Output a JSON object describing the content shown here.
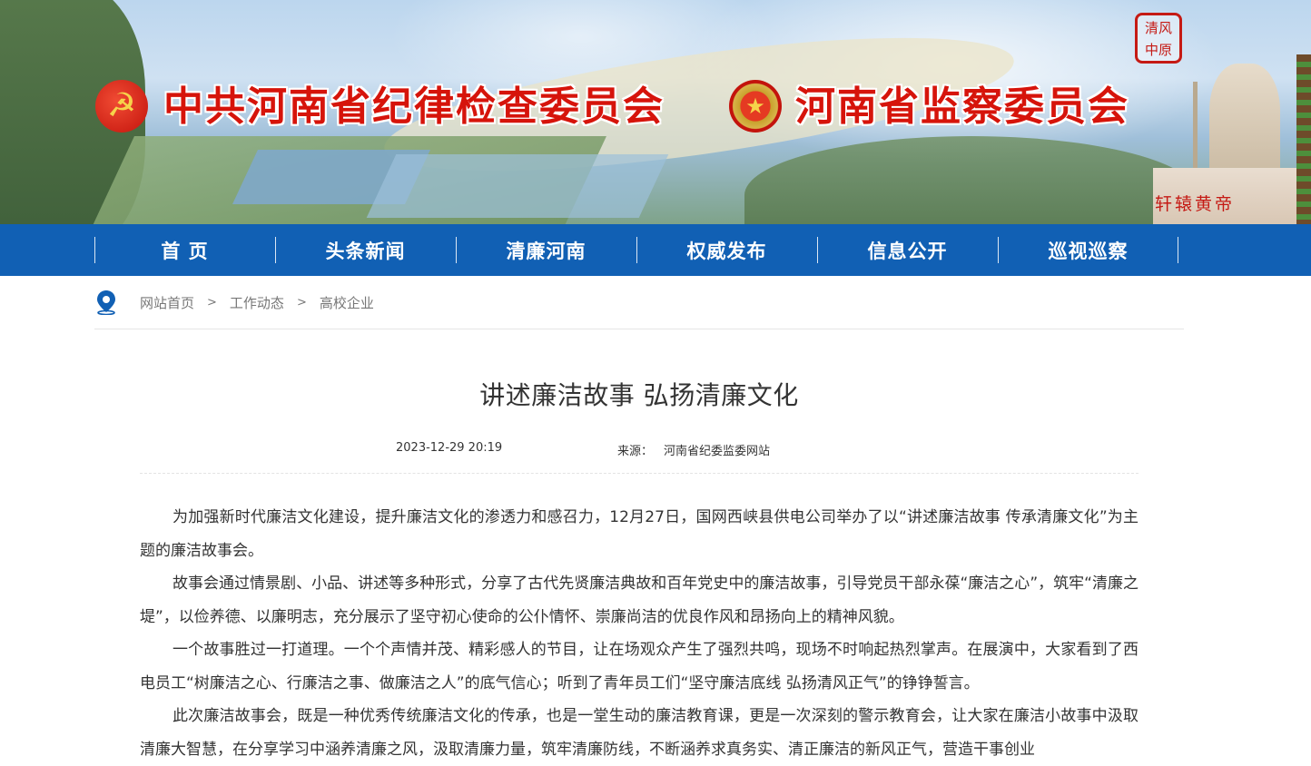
{
  "header": {
    "org1": "中共河南省纪律检查委员会",
    "org2": "河南省监察委员会",
    "seal_text": [
      "清风",
      "中原"
    ],
    "statue_plaque": "轩辕黄帝",
    "party_emblem_icon": "party-emblem-icon",
    "state_emblem_icon": "state-emblem-icon"
  },
  "nav": {
    "items": [
      "首 页",
      "头条新闻",
      "清廉河南",
      "权威发布",
      "信息公开",
      "巡视巡察"
    ],
    "bg_color": "#1160b4"
  },
  "breadcrumb": {
    "icon": "location-pin-icon",
    "items": [
      "网站首页",
      "工作动态",
      "高校企业"
    ],
    "separator": ">"
  },
  "article": {
    "title": "讲述廉洁故事 弘扬清廉文化",
    "date": "2023-12-29 20:19",
    "source_label": "来源：",
    "source": "河南省纪委监委网站",
    "paragraphs": [
      "为加强新时代廉洁文化建设，提升廉洁文化的渗透力和感召力，12月27日，国网西峡县供电公司举办了以“讲述廉洁故事 传承清廉文化”为主题的廉洁故事会。",
      "故事会通过情景剧、小品、讲述等多种形式，分享了古代先贤廉洁典故和百年党史中的廉洁故事，引导党员干部永葆“廉洁之心”，筑牢“清廉之堤”，以俭养德、以廉明志，充分展示了坚守初心使命的公仆情怀、崇廉尚洁的优良作风和昂扬向上的精神风貌。",
      "一个故事胜过一打道理。一个个声情并茂、精彩感人的节目，让在场观众产生了强烈共鸣，现场不时响起热烈掌声。在展演中，大家看到了西电员工“树廉洁之心、行廉洁之事、做廉洁之人”的底气信心；听到了青年员工们“坚守廉洁底线 弘扬清风正气”的铮铮誓言。",
      "此次廉洁故事会，既是一种优秀传统廉洁文化的传承，也是一堂生动的廉洁教育课，更是一次深刻的警示教育会，让大家在廉洁小故事中汲取清廉大智慧，在分享学习中涵养清廉之风，汲取清廉力量，筑牢清廉防线，不断涵养求真务实、清正廉洁的新风正气，营造干事创业"
    ]
  }
}
